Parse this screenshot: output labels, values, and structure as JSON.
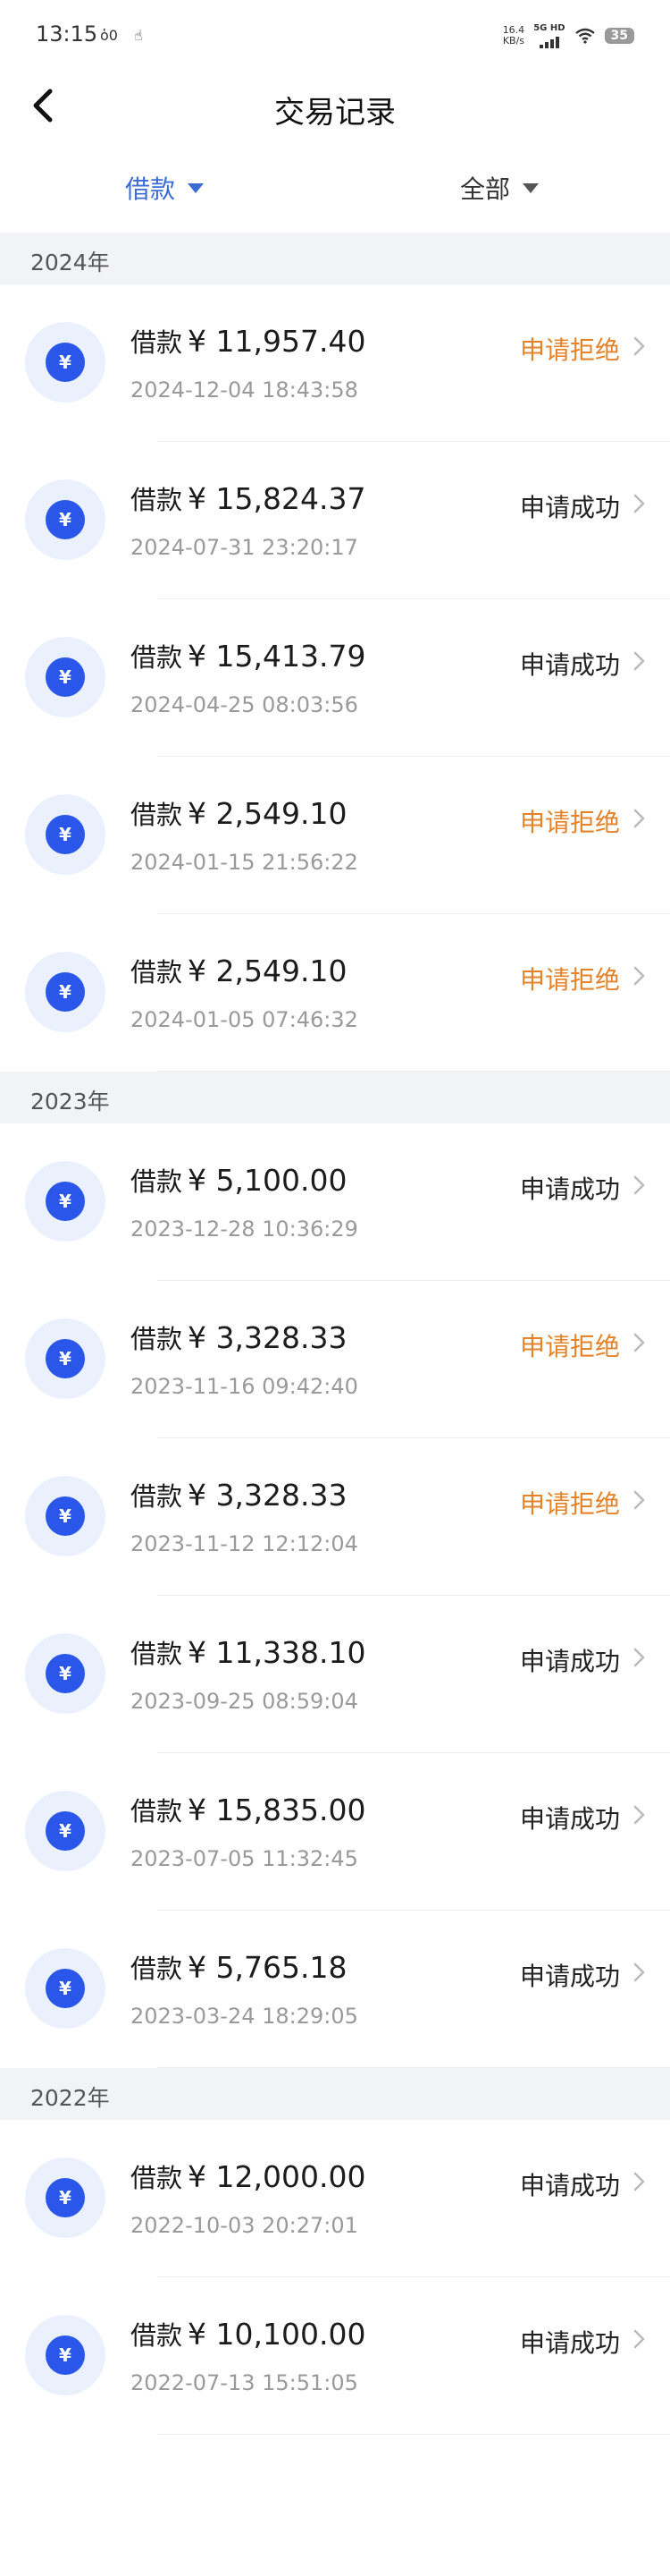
{
  "status_bar": {
    "time": "13:15",
    "net_speed_value": "16.4",
    "net_speed_unit": "KB/s",
    "network": "5G HD",
    "battery": "35"
  },
  "header": {
    "title": "交易记录"
  },
  "filters": {
    "type_label": "借款",
    "status_label": "全部"
  },
  "groups": [
    {
      "year": "2024年",
      "records": [
        {
          "label": "借款",
          "amount": "¥ 11,957.40",
          "date": "2024-12-04 18:43:58",
          "status": "申请拒绝",
          "state": "rejected"
        },
        {
          "label": "借款",
          "amount": "¥ 15,824.37",
          "date": "2024-07-31 23:20:17",
          "status": "申请成功",
          "state": "success"
        },
        {
          "label": "借款",
          "amount": "¥ 15,413.79",
          "date": "2024-04-25 08:03:56",
          "status": "申请成功",
          "state": "success"
        },
        {
          "label": "借款",
          "amount": "¥ 2,549.10",
          "date": "2024-01-15 21:56:22",
          "status": "申请拒绝",
          "state": "rejected"
        },
        {
          "label": "借款",
          "amount": "¥ 2,549.10",
          "date": "2024-01-05 07:46:32",
          "status": "申请拒绝",
          "state": "rejected"
        }
      ]
    },
    {
      "year": "2023年",
      "records": [
        {
          "label": "借款",
          "amount": "¥ 5,100.00",
          "date": "2023-12-28 10:36:29",
          "status": "申请成功",
          "state": "success"
        },
        {
          "label": "借款",
          "amount": "¥ 3,328.33",
          "date": "2023-11-16 09:42:40",
          "status": "申请拒绝",
          "state": "rejected"
        },
        {
          "label": "借款",
          "amount": "¥ 3,328.33",
          "date": "2023-11-12 12:12:04",
          "status": "申请拒绝",
          "state": "rejected"
        },
        {
          "label": "借款",
          "amount": "¥ 11,338.10",
          "date": "2023-09-25 08:59:04",
          "status": "申请成功",
          "state": "success"
        },
        {
          "label": "借款",
          "amount": "¥ 15,835.00",
          "date": "2023-07-05 11:32:45",
          "status": "申请成功",
          "state": "success"
        },
        {
          "label": "借款",
          "amount": "¥ 5,765.18",
          "date": "2023-03-24 18:29:05",
          "status": "申请成功",
          "state": "success"
        }
      ]
    },
    {
      "year": "2022年",
      "records": [
        {
          "label": "借款",
          "amount": "¥ 12,000.00",
          "date": "2022-10-03 20:27:01",
          "status": "申请成功",
          "state": "success"
        },
        {
          "label": "借款",
          "amount": "¥ 10,100.00",
          "date": "2022-07-13 15:51:05",
          "status": "申请成功",
          "state": "success"
        }
      ]
    }
  ],
  "icons": {
    "back": "back-arrow-icon",
    "coin": "yuan-coin-icon",
    "chevron": "chevron-right-icon",
    "dropdown": "dropdown-triangle-icon"
  },
  "colors": {
    "accent_blue": "#3b6cd6",
    "coin_blue": "#2a56ea",
    "rejected_orange": "#e5832a",
    "section_bg": "#f2f3f5"
  }
}
